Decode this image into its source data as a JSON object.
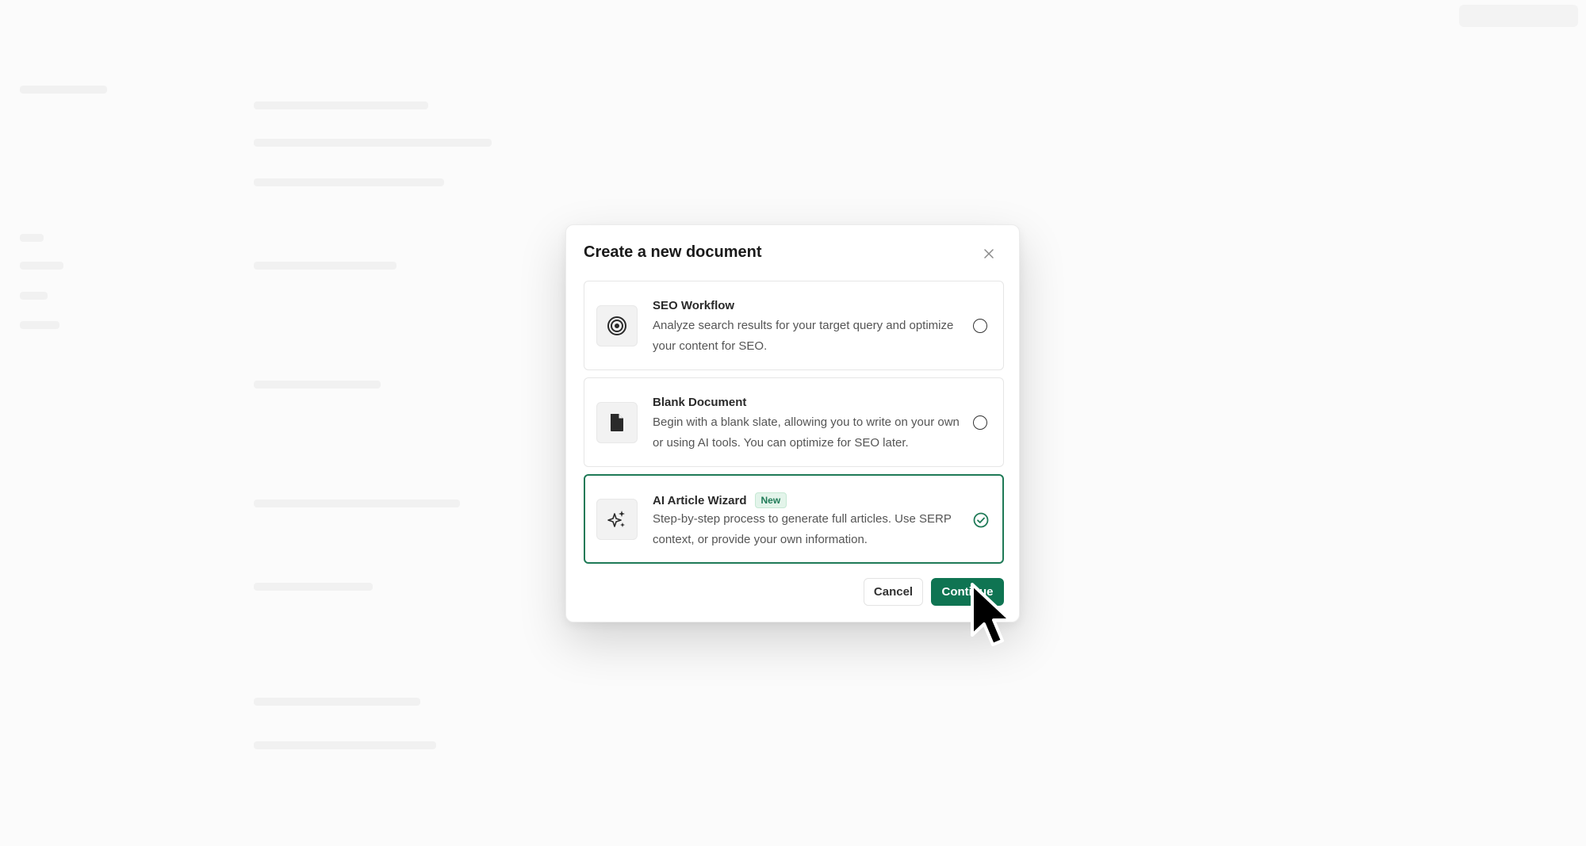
{
  "modal": {
    "title": "Create a new document",
    "close_icon": "close-icon",
    "options": [
      {
        "title": "SEO Workflow",
        "description": "Analyze search results for your target query and optimize your content for SEO.",
        "icon": "target-icon",
        "selected": false
      },
      {
        "title": "Blank Document",
        "description": "Begin with a blank slate, allowing you to write on your own or using AI tools. You can optimize for SEO later.",
        "icon": "document-icon",
        "selected": false
      },
      {
        "title": "AI Article Wizard",
        "badge": "New",
        "description": "Step-by-step process to generate full articles. Use SERP context, or provide your own information.",
        "icon": "sparkles-icon",
        "selected": true
      }
    ],
    "cancel_label": "Cancel",
    "continue_label": "Continue"
  },
  "colors": {
    "accent": "#0f7452",
    "selected_border": "#1f7a57",
    "badge_bg": "#e3f4ea"
  }
}
